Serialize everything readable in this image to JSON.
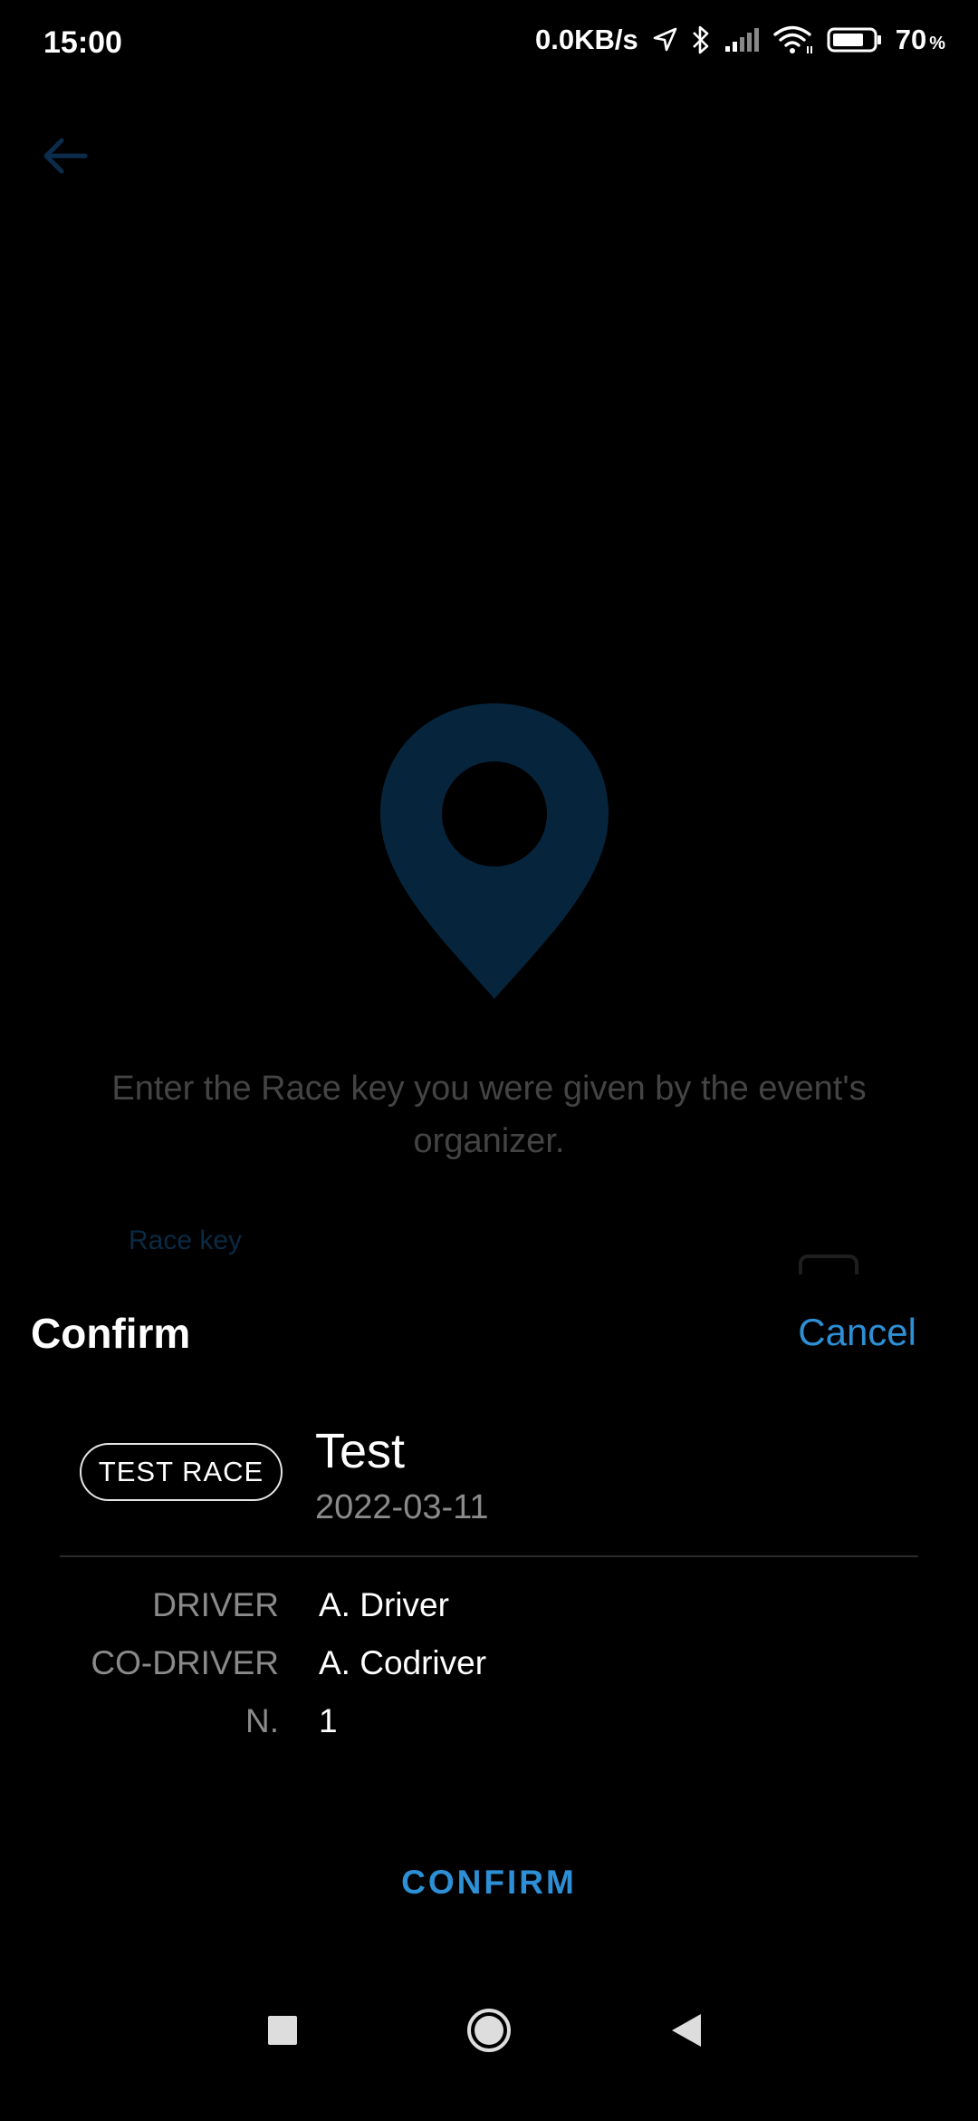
{
  "status_bar": {
    "time": "15:00",
    "network_speed": "0.0KB/s",
    "battery_percent": "70",
    "battery_unit": "%",
    "icons": [
      "location-arrow-icon",
      "bluetooth-icon",
      "signal-icon",
      "wifi-icon",
      "battery-icon"
    ]
  },
  "background": {
    "back_icon": "arrow-left-icon",
    "pin_icon": "location-pin-icon",
    "instructions": "Enter the Race key you were given by the event's organizer.",
    "race_key_label": "Race key"
  },
  "sheet": {
    "title": "Confirm",
    "cancel_label": "Cancel",
    "race_badge": "TEST RACE",
    "race_name": "Test",
    "race_date": "2022-03-11",
    "rows": [
      {
        "label": "DRIVER",
        "value": "A. Driver"
      },
      {
        "label": "CO-DRIVER",
        "value": "A. Codriver"
      },
      {
        "label": "N.",
        "value": "1"
      }
    ],
    "confirm_label": "CONFIRM"
  },
  "nav_bar": {
    "icons": [
      "recent-apps-icon",
      "home-icon",
      "back-triangle-icon"
    ]
  },
  "colors": {
    "accent": "#2d8fd5",
    "background": "#000000",
    "pin": "#06253d",
    "muted_text": "#8a8a8a"
  }
}
